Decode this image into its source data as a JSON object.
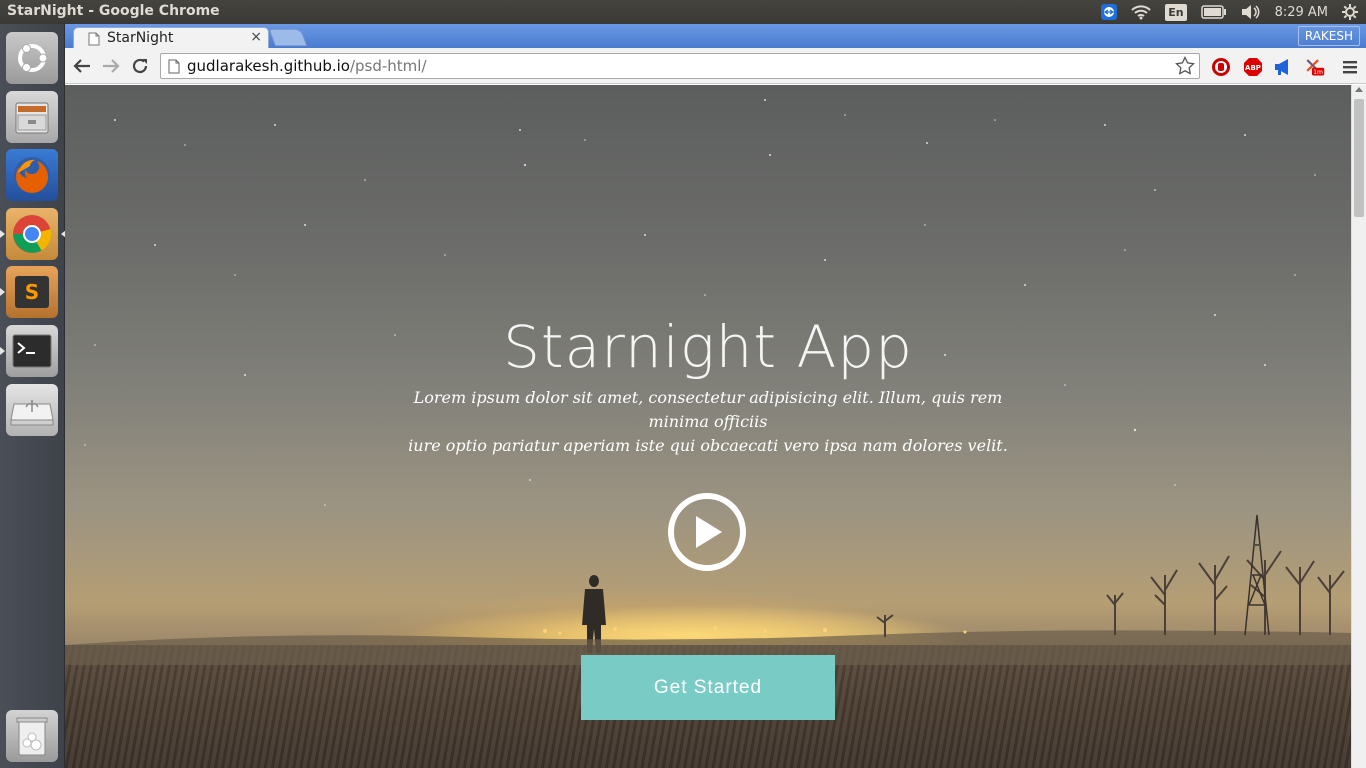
{
  "panel": {
    "window_title": "StarNight - Google Chrome",
    "language": "En",
    "time": "8:29 AM"
  },
  "launcher": {
    "items": [
      {
        "name": "dash-home-icon"
      },
      {
        "name": "files-icon"
      },
      {
        "name": "firefox-icon"
      },
      {
        "name": "chrome-icon"
      },
      {
        "name": "sublime-text-icon"
      },
      {
        "name": "terminal-icon"
      },
      {
        "name": "usb-drive-icon"
      },
      {
        "name": "trash-icon"
      }
    ]
  },
  "browser": {
    "tab_title": "StarNight",
    "tab_close": "×",
    "profile": "RAKESH",
    "url_host": "gudlarakesh.github.io",
    "url_path": "/psd-html/",
    "abp_label": "ABP",
    "ext_badge": "1m"
  },
  "page": {
    "title": "Starnight App",
    "subtitle_line1": "Lorem ipsum dolor sit amet, consectetur adipisicing elit. Illum, quis rem minima officiis",
    "subtitle_line2": "iure optio pariatur aperiam iste qui obcaecati vero ipsa nam dolores velit.",
    "cta_label": "Get Started"
  },
  "colors": {
    "accent": "#79cbc6",
    "tabstrip": "#5a89d6",
    "panel": "#3c3b37"
  }
}
